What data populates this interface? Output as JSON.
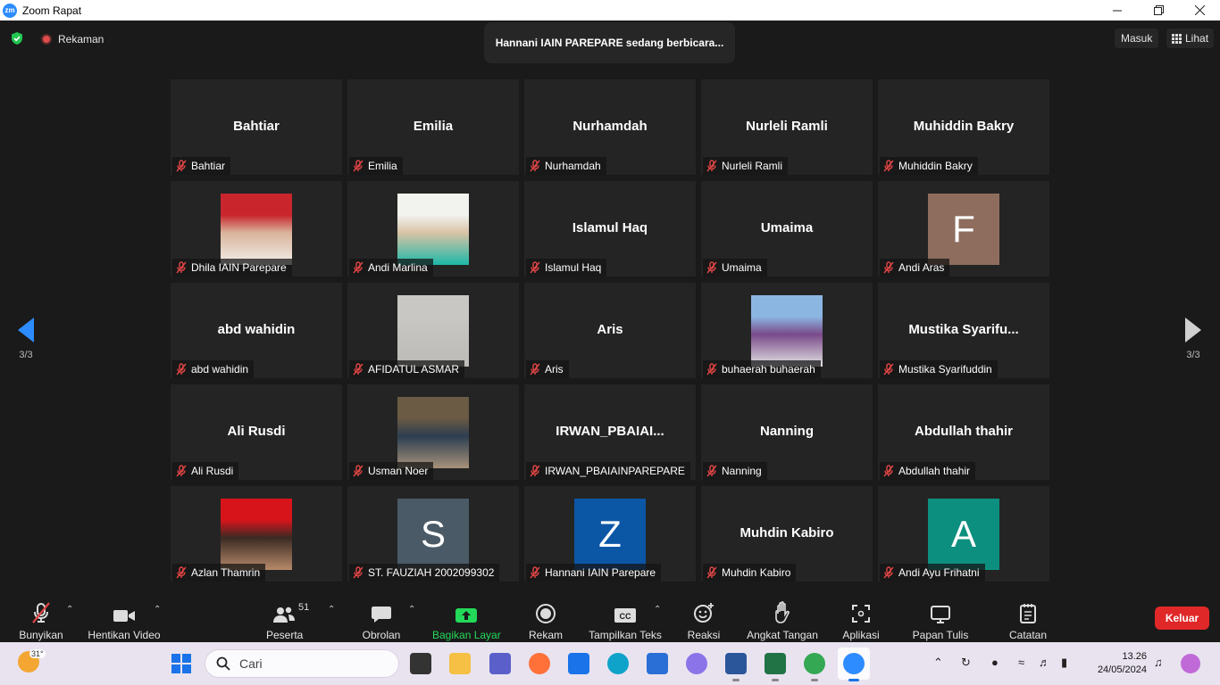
{
  "window": {
    "app_logo": "zm",
    "title": "Zoom Rapat",
    "minimize_icon": "minimize-icon",
    "maximize_icon": "restore-icon",
    "close_icon": "close-icon"
  },
  "top_bar": {
    "recording_label": "Rekaman",
    "speaking_banner": "Hannani IAIN PAREPARE sedang berbicara...",
    "signin_label": "Masuk",
    "view_label": "Lihat"
  },
  "pager": {
    "left_label": "3/3",
    "right_label": "3/3"
  },
  "participants": [
    {
      "display": "Bahtiar",
      "name": "Bahtiar",
      "kind": "name"
    },
    {
      "display": "Emilia",
      "name": "Emilia",
      "kind": "name"
    },
    {
      "display": "Nurhamdah",
      "name": "Nurhamdah",
      "kind": "name"
    },
    {
      "display": "Nurleli Ramli",
      "name": "Nurleli Ramli",
      "kind": "name"
    },
    {
      "display": "Muhiddin Bakry",
      "name": "Muhiddin Bakry",
      "kind": "name"
    },
    {
      "display": "",
      "name": "Dhila IAIN Parepare",
      "kind": "photo",
      "colors": [
        "#c8252c",
        "#f1efe9",
        "#d9b49c"
      ]
    },
    {
      "display": "",
      "name": "Andi Marlina",
      "kind": "photo",
      "colors": [
        "#f2f2ee",
        "#1db8a8",
        "#d9c3a6"
      ]
    },
    {
      "display": "Islamul Haq",
      "name": "Islamul Haq",
      "kind": "name"
    },
    {
      "display": "Umaima",
      "name": "Umaima",
      "kind": "name"
    },
    {
      "display": "F",
      "name": "Andi Aras",
      "kind": "avatar",
      "colors": [
        "#8e6d5e"
      ]
    },
    {
      "display": "abd wahidin",
      "name": "abd wahidin",
      "kind": "name"
    },
    {
      "display": "",
      "name": "AFIDATUL ASMAR",
      "kind": "photo",
      "colors": [
        "#c9c7c3",
        "#bdbbb7",
        "#c4c2be"
      ]
    },
    {
      "display": "Aris",
      "name": "Aris",
      "kind": "name"
    },
    {
      "display": "",
      "name": "buhaerah buhaerah",
      "kind": "photo",
      "colors": [
        "#8bb6e2",
        "#e4e4e4",
        "#7a4a8a"
      ]
    },
    {
      "display": "Mustika  Syarifu...",
      "name": "Mustika Syarifuddin",
      "kind": "name"
    },
    {
      "display": "Ali Rusdi",
      "name": "Ali Rusdi",
      "kind": "name"
    },
    {
      "display": "",
      "name": "Usman Noer",
      "kind": "photo",
      "colors": [
        "#6b5a44",
        "#a8927a",
        "#2c3e50"
      ]
    },
    {
      "display": "IRWAN_PBAIAI...",
      "name": "IRWAN_PBAIAINPAREPARE",
      "kind": "name"
    },
    {
      "display": "Nanning",
      "name": "Nanning",
      "kind": "name"
    },
    {
      "display": "Abdullah thahir",
      "name": "Abdullah thahir",
      "kind": "name"
    },
    {
      "display": "",
      "name": "Azlan Thamrin",
      "kind": "photo",
      "colors": [
        "#d8141b",
        "#b88a6a",
        "#3a2a22"
      ]
    },
    {
      "display": "S",
      "name": "ST. FAUZIAH 2002099302",
      "kind": "avatar",
      "colors": [
        "#4a5a66"
      ]
    },
    {
      "display": "Z",
      "name": "Hannani IAIN Parepare",
      "kind": "avatar",
      "colors": [
        "#0c56a6"
      ]
    },
    {
      "display": "Muhdin Kabiro",
      "name": "Muhdin Kabiro",
      "kind": "name"
    },
    {
      "display": "A",
      "name": "Andi Ayu Frihatni",
      "kind": "avatar",
      "colors": [
        "#0d8f7f"
      ]
    }
  ],
  "toolbar": {
    "unmute": "Bunyikan",
    "stop_video": "Hentikan Video",
    "participants": "Peserta",
    "participants_count": "51",
    "chat": "Obrolan",
    "share_screen": "Bagikan Layar",
    "record": "Rekam",
    "captions": "Tampilkan Teks",
    "captions_badge": "CC",
    "reactions": "Reaksi",
    "raise_hand": "Angkat Tangan",
    "apps": "Aplikasi",
    "whiteboard": "Papan Tulis",
    "notes": "Catatan",
    "leave": "Keluar"
  },
  "taskbar": {
    "weather_temp": "31°",
    "search_placeholder": "Cari",
    "time": "13.26",
    "date": "24/05/2024",
    "apps": [
      "task-view-icon",
      "file-explorer-icon",
      "teams-icon",
      "firefox-icon",
      "mail-icon",
      "edge-icon",
      "vscode-icon",
      "copilot-icon",
      "word-icon",
      "excel-icon",
      "chrome-icon",
      "zoom-icon"
    ]
  },
  "colors": {
    "background": "#1a1a1a",
    "tile": "#242424",
    "accent": "#2d8cff",
    "share_green": "#23d959",
    "leave_red": "#e02828",
    "taskbar": "#e9e3f0"
  }
}
